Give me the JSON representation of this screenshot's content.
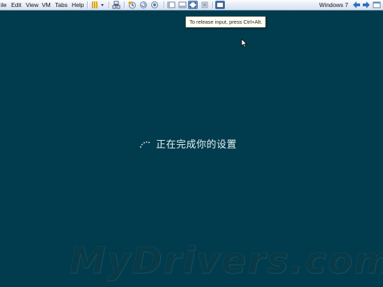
{
  "menubar": {
    "items": [
      "ile",
      "Edit",
      "View",
      "VM",
      "Tabs",
      "Help"
    ],
    "vm_name": "Windows 7"
  },
  "tooltip": {
    "text": "To release input, press Ctrl+Alt."
  },
  "guest": {
    "status_text": "正在完成你的设置",
    "background": "#003c4d"
  },
  "watermark": {
    "text": "MyDrivers.com"
  }
}
